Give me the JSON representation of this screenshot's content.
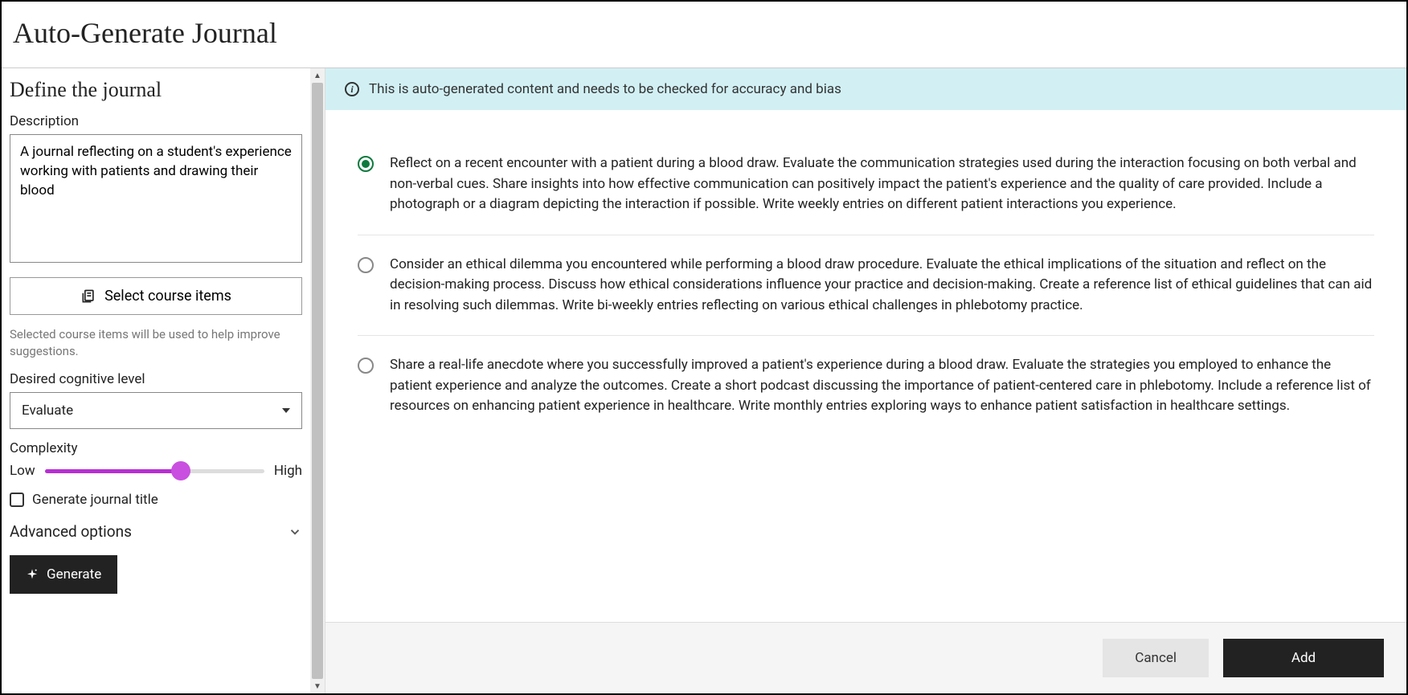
{
  "header": {
    "title": "Auto-Generate Journal"
  },
  "sidebar": {
    "section_title": "Define the journal",
    "description_label": "Description",
    "description_value": "A journal reflecting on a student's experience working with patients and drawing their blood",
    "select_course_label": "Select course items",
    "hint": "Selected course items will be used to help improve suggestions.",
    "cognitive_label": "Desired cognitive level",
    "cognitive_value": "Evaluate",
    "complexity_label": "Complexity",
    "complexity_low": "Low",
    "complexity_high": "High",
    "complexity_percent": 62,
    "generate_title_label": "Generate journal title",
    "generate_title_checked": false,
    "advanced_label": "Advanced options",
    "generate_button": "Generate"
  },
  "main": {
    "banner": "This is auto-generated content and needs to be checked for accuracy and bias",
    "options": [
      {
        "selected": true,
        "text": "Reflect on a recent encounter with a patient during a blood draw. Evaluate the communication strategies used during the interaction focusing on both verbal and non-verbal cues. Share insights into how effective communication can positively impact the patient's experience and the quality of care provided. Include a photograph or a diagram depicting the interaction if possible. Write weekly entries on different patient interactions you experience."
      },
      {
        "selected": false,
        "text": "Consider an ethical dilemma you encountered while performing a blood draw procedure. Evaluate the ethical implications of the situation and reflect on the decision-making process. Discuss how ethical considerations influence your practice and decision-making. Create a reference list of ethical guidelines that can aid in resolving such dilemmas. Write bi-weekly entries reflecting on various ethical challenges in phlebotomy practice."
      },
      {
        "selected": false,
        "text": "Share a real-life anecdote where you successfully improved a patient's experience during a blood draw. Evaluate the strategies you employed to enhance the patient experience and analyze the outcomes. Create a short podcast discussing the importance of patient-centered care in phlebotomy. Include a reference list of resources on enhancing patient experience in healthcare. Write monthly entries exploring ways to enhance patient satisfaction in healthcare settings."
      }
    ],
    "footer": {
      "cancel": "Cancel",
      "add": "Add"
    }
  }
}
